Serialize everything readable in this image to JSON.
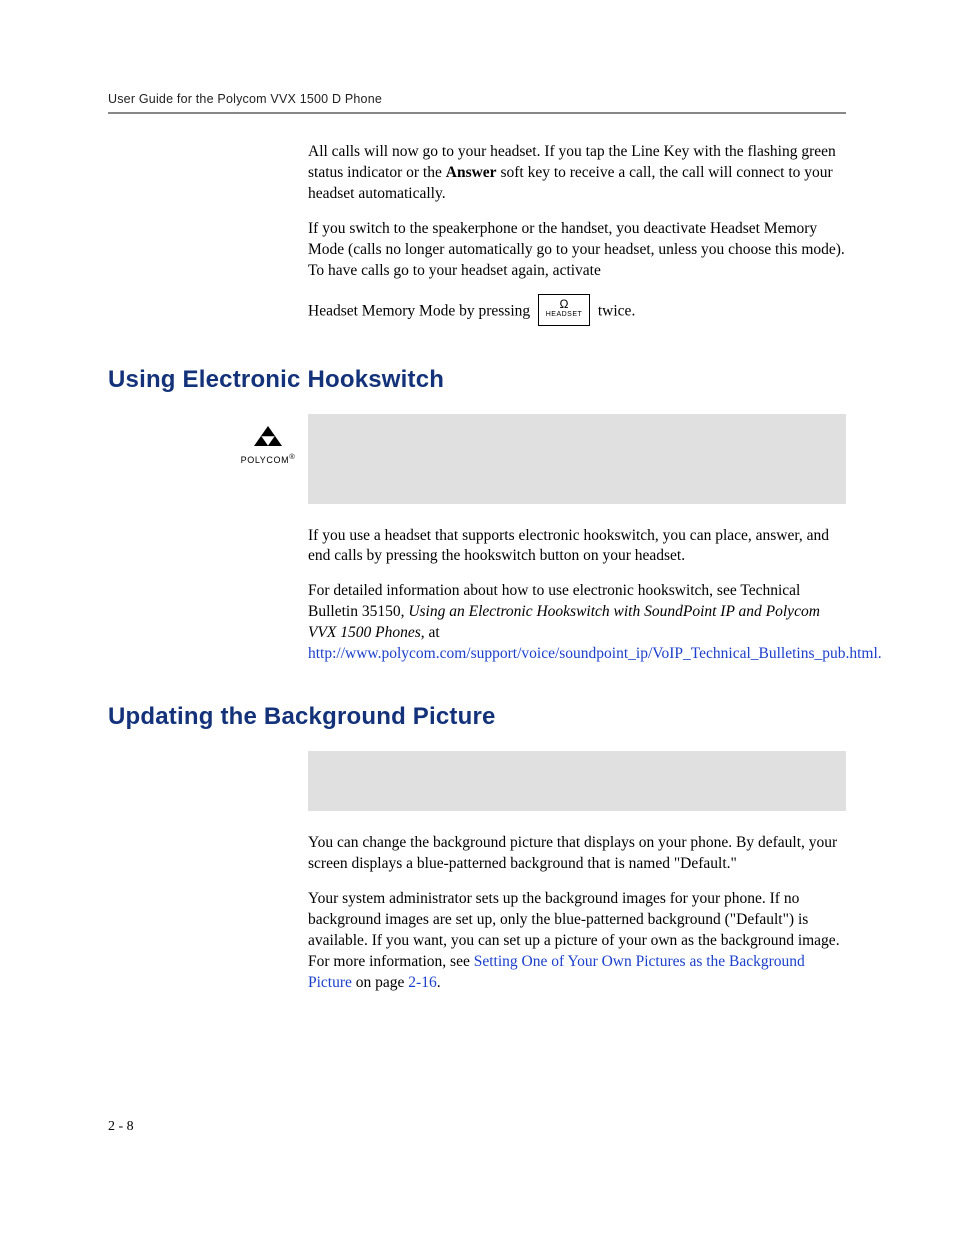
{
  "header": {
    "running_head": "User Guide for the Polycom VVX 1500 D Phone"
  },
  "p1_a": "All calls will now go to your headset. If you tap the Line Key with the flashing green status indicator or the ",
  "p1_b": "Answer",
  "p1_c": " soft key to receive a call, the call will connect to your headset automatically.",
  "p2": "If you switch to the speakerphone or the handset, you deactivate Headset Memory Mode (calls no longer automatically go to your headset, unless you choose this mode). To have calls go to your headset again, activate",
  "p3_a": "Headset Memory Mode by pressing ",
  "p3_key": {
    "icon": "Ω",
    "label": "HEADSET"
  },
  "p3_b": " twice.",
  "h1": "Using Electronic Hookswitch",
  "logo_word": "POLYCOM",
  "p4": "If you use a headset that supports electronic hookswitch, you can place, answer, and end calls by pressing the hookswitch button on your headset.",
  "p5_a": "For detailed information about how to use electronic hookswitch, see Technical Bulletin 35150, ",
  "p5_i": "Using an Electronic Hookswitch with SoundPoint IP and Polycom VVX 1500 Phones",
  "p5_b": ", at ",
  "p5_link": "http://www.polycom.com/support/voice/soundpoint_ip/VoIP_Technical_Bulletins_pub.html.",
  "h2": "Updating the Background Picture",
  "p6": "You can change the background picture that displays on your phone. By default, your screen displays a blue-patterned background that is named \"Default.\"",
  "p7_a": "Your system administrator sets up the background images for your phone. If no background images are set up, only the blue-patterned background (\"Default\") is available. If you want, you can set up a picture of your own as the background image. For more information, see ",
  "p7_link": "Setting One of Your Own Pictures as the Background Picture",
  "p7_b": " on page ",
  "p7_page": "2-16",
  "p7_c": ".",
  "footer": "2 - 8"
}
